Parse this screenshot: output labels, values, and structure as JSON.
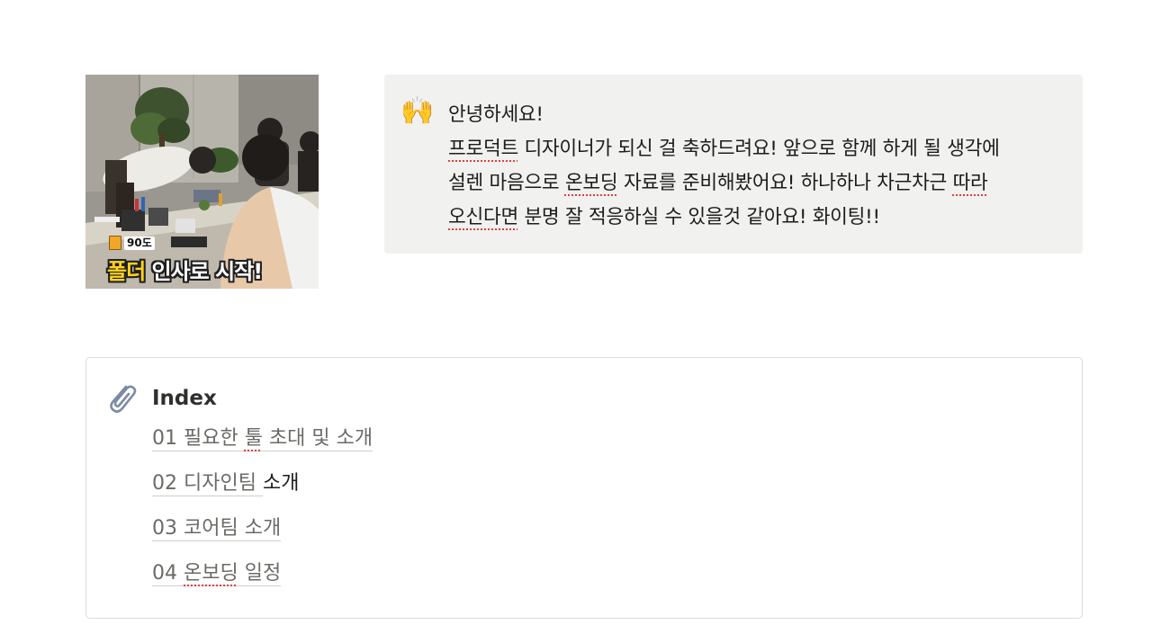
{
  "image": {
    "badge": "90도",
    "caption_highlight": "폴더",
    "caption_rest": " 인사로 시작!"
  },
  "callout": {
    "icon": "raising-hands-emoji",
    "icon_glyph": "🙌",
    "greeting": "안녕하세요!",
    "line1_word": "프로덕트",
    "line1_rest": " 디자이너가 되신 걸 축하드려요! 앞으로 함께 하게 될 생각에",
    "line2_a": "설렌 마음으로 ",
    "line2_word": "온보딩",
    "line2_b": " 자료를 준비해봤어요! 하나하나 차근차근 ",
    "line2_word2": "따라",
    "line3_word": "오신다면",
    "line3_rest": " 분명 잘 적응하실 수 있을것 같아요! 화이팅!!"
  },
  "index": {
    "icon": "paperclip-icon",
    "title": "Index",
    "items": [
      {
        "link_a": "01 필요한 ",
        "link_spell": "툴",
        "link_b": " 초대 및 소개",
        "rest": ""
      },
      {
        "link_a": "02 디자인팀 ",
        "link_spell": "",
        "link_b": "",
        "rest": "소개"
      },
      {
        "link_a": "03 코어팀 소개",
        "link_spell": "",
        "link_b": "",
        "rest": ""
      },
      {
        "link_a": "04 ",
        "link_spell": "온보딩",
        "link_b": " 일정",
        "rest": ""
      }
    ]
  }
}
